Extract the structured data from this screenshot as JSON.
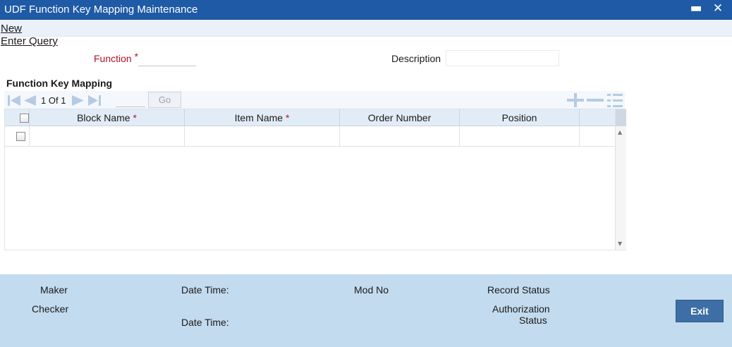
{
  "window": {
    "title": "UDF Function Key Mapping Maintenance",
    "minimize_glyph": "▬",
    "close_glyph": "✕"
  },
  "menu": {
    "new_label": "New",
    "enter_query_label": "Enter Query"
  },
  "form": {
    "function_label": "Function",
    "required_mark": "*",
    "function_value": "",
    "description_label": "Description",
    "description_value": ""
  },
  "section": {
    "title": "Function Key Mapping"
  },
  "pager": {
    "current": "1",
    "of_label": "Of",
    "total": "1",
    "page_input_value": "",
    "go_label": "Go"
  },
  "table": {
    "columns": [
      {
        "label": "Block Name",
        "required": "*"
      },
      {
        "label": "Item Name",
        "required": "*"
      },
      {
        "label": "Order Number"
      },
      {
        "label": "Position"
      }
    ],
    "rows": [
      {
        "block_name": "",
        "item_name": "",
        "order_number": "",
        "position": ""
      }
    ]
  },
  "footer": {
    "maker_label": "Maker",
    "checker_label": "Checker",
    "date_time_label_1": "Date Time:",
    "date_time_label_2": "Date Time:",
    "mod_no_label": "Mod No",
    "record_status_label": "Record Status",
    "authorization_status_label_line1": "Authorization",
    "authorization_status_label_line2": "Status",
    "exit_label": "Exit"
  },
  "colors": {
    "titlebar": "#1f5aa6",
    "footer": "#c3dbee",
    "exit_button": "#3d6fa6",
    "required": "#b0142a",
    "icon": "#b5cbe3"
  }
}
